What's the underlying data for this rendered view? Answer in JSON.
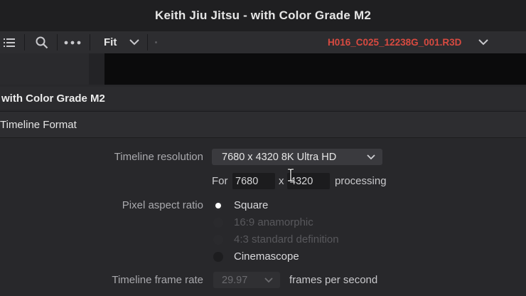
{
  "window": {
    "title": "Keith Jiu Jitsu - with Color Grade M2"
  },
  "toolbar": {
    "list_icon": "list-icon",
    "search_icon": "search-icon",
    "more_icon": "more-options-icon",
    "zoom_value": "Fit",
    "clip_name": "H016_C025_12238G_001.R3D",
    "clip_color": "#d84a40"
  },
  "panel": {
    "title": "with Color Grade M2"
  },
  "section": {
    "title": "Timeline Format"
  },
  "settings": {
    "resolution_label": "Timeline resolution",
    "resolution_value": "7680 x 4320 8K Ultra HD",
    "for_label": "For",
    "width_value": "7680",
    "times_label": "x",
    "height_value": "4320",
    "processing_label": "processing",
    "pixel_aspect_label": "Pixel aspect ratio",
    "pixel_aspect_options": [
      {
        "label": "Square",
        "selected": true,
        "enabled": true
      },
      {
        "label": "16:9 anamorphic",
        "selected": false,
        "enabled": false
      },
      {
        "label": "4:3 standard definition",
        "selected": false,
        "enabled": false
      },
      {
        "label": "Cinemascope",
        "selected": false,
        "enabled": true
      }
    ],
    "frame_rate_label": "Timeline frame rate",
    "frame_rate_value": "29.97",
    "frame_rate_unit": "frames per second"
  }
}
